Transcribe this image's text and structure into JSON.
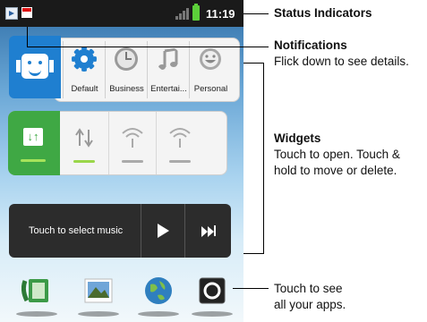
{
  "status_bar": {
    "time": "11:19"
  },
  "profiles": {
    "items": [
      "Default",
      "Business",
      "Entertai...",
      "Personal"
    ]
  },
  "music_widget": {
    "prompt": "Touch to select music"
  },
  "callouts": {
    "status_indicators": "Status Indicators",
    "notifications_title": "Notifications",
    "notifications_desc": "Flick down to see details.",
    "widgets_title": "Widgets",
    "widgets_desc_line1": "Touch to open. Touch &",
    "widgets_desc_line2": "hold to move or delete.",
    "apps_line1": "Touch to see",
    "apps_line2": "all your apps."
  },
  "icons": [
    "notification-icon",
    "calendar-icon",
    "signal-icon",
    "battery-icon",
    "profile-face-icon",
    "gear-icon",
    "clock-icon",
    "music-note-icon",
    "smiley-icon",
    "data-sync-icon",
    "wifi-icon",
    "play-icon",
    "next-track-icon",
    "phone-icon",
    "gallery-icon",
    "browser-globe-icon",
    "apps-launcher-icon"
  ]
}
